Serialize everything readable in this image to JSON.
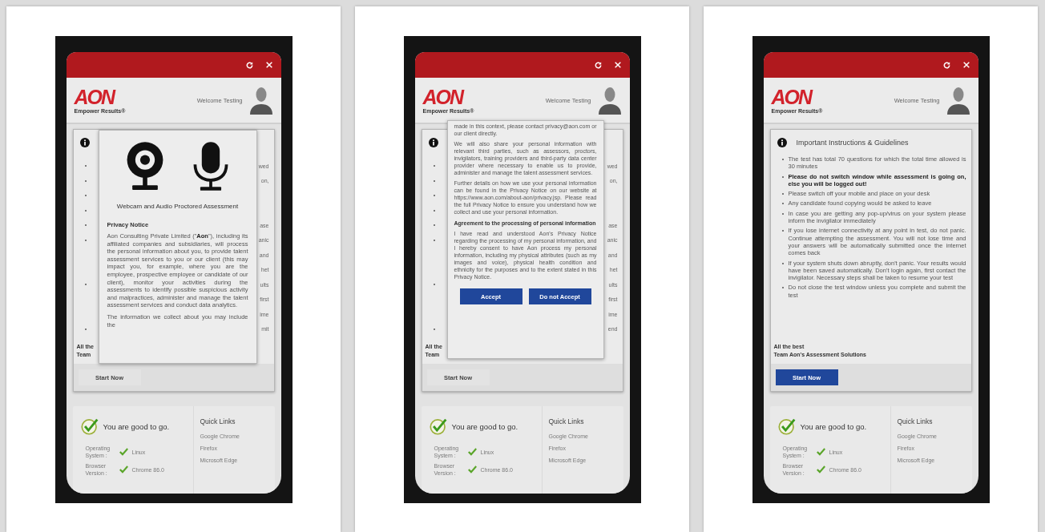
{
  "screens": [
    {
      "header": {
        "welcome": "Welcome Testing",
        "logo": "AON",
        "tagline": "Empower Results®"
      },
      "instructions": {
        "peek_lines": [
          {
            "kind": "bullet",
            "text": "wed"
          },
          {
            "kind": "bullet",
            "text": "on,"
          },
          {
            "kind": "bullet"
          },
          {
            "kind": "bullet"
          },
          {
            "kind": "bullet",
            "text": "ase"
          },
          {
            "kind": "bullet",
            "text": "anic"
          },
          {
            "kind": "line",
            "text": "and"
          },
          {
            "kind": "line",
            "text": "het"
          },
          {
            "kind": "bullet",
            "text": "ults"
          },
          {
            "kind": "line",
            "text": "first"
          },
          {
            "kind": "line",
            "text": "ime"
          },
          {
            "kind": "bullet",
            "text": "mit"
          }
        ],
        "signoff": [
          "All the",
          "Team"
        ],
        "start_button": {
          "label": "Start Now",
          "enabled": false
        }
      },
      "modal": {
        "kind": "intro",
        "blocks": [
          {
            "kind": "media"
          },
          {
            "kind": "title",
            "text": "Webcam and Audio Proctored Assessment"
          },
          {
            "kind": "heading",
            "text": "Privacy Notice"
          },
          {
            "kind": "paragraph",
            "text": "Aon Consulting Private Limited (\"**Aon**\"), including its affiliated companies and subsidiaries, will process the personal information about you, to provide talent assessment services to you or our client (this may impact you, for example, where you are the employee, prospective employee or candidate of our client), monitor your activities during the assessments to identify possible suspicious activity and malpractices, administer and manage the talent assessment services and conduct data analytics."
          },
          {
            "kind": "paragraph",
            "text": "The information we collect about you may include the"
          }
        ]
      },
      "status": {
        "title": "You are good to go.",
        "checks": [
          {
            "label": "Operating System :",
            "value": "Linux"
          },
          {
            "label": "Browser Version :",
            "value": "Chrome 86.0"
          }
        ],
        "quick_links": {
          "title": "Quick Links",
          "items": [
            "Google Chrome",
            "Firefox",
            "Microsoft Edge"
          ]
        }
      }
    },
    {
      "header": {
        "welcome": "Welcome Testing",
        "logo": "AON",
        "tagline": "Empower Results®"
      },
      "instructions": {
        "peek_lines": [
          {
            "kind": "bullet",
            "text": "wed"
          },
          {
            "kind": "bullet",
            "text": "on,"
          },
          {
            "kind": "bullet"
          },
          {
            "kind": "bullet"
          },
          {
            "kind": "bullet",
            "text": "ase"
          },
          {
            "kind": "bullet",
            "text": "anic"
          },
          {
            "kind": "line",
            "text": "and"
          },
          {
            "kind": "line",
            "text": "het"
          },
          {
            "kind": "bullet",
            "text": "ults"
          },
          {
            "kind": "line",
            "text": "first"
          },
          {
            "kind": "line",
            "text": "ime"
          },
          {
            "kind": "bullet",
            "text": "end"
          }
        ],
        "signoff": [
          "All the",
          "Team"
        ],
        "start_button": {
          "label": "Start Now",
          "enabled": false
        }
      },
      "modal": {
        "kind": "consent",
        "blocks": [
          {
            "kind": "paragraph",
            "text": "made in this context, please contact privacy@aon.com or our client directly."
          },
          {
            "kind": "paragraph",
            "text": "We will also share your personal information with relevant third parties, such as assessors, proctors, invigilators, training providers and third-party data center provider where necessary to enable us to provide, administer and manage the talent assessment services."
          },
          {
            "kind": "paragraph",
            "text": "Further details on how we use your personal information can be found in the Privacy Notice on our website at https://www.aon.com/about-aon/privacy.jsp. Please read the full Privacy Notice to ensure you understand how we collect and use your personal information."
          },
          {
            "kind": "heading",
            "text": "Agreement to the processing of personal information"
          },
          {
            "kind": "paragraph",
            "text": "I have read and understood Aon's Privacy Notice regarding the processing of my personal information, and I hereby consent to have Aon process my personal information, including my physical attributes (such as my images and voice), physical health condition and ethnicity for the purposes and to the extent stated in this Privacy Notice."
          }
        ],
        "buttons": [
          "Accept",
          "Do not Accept"
        ]
      },
      "status": {
        "title": "You are good to go.",
        "checks": [
          {
            "label": "Operating System :",
            "value": "Linux"
          },
          {
            "label": "Browser Version :",
            "value": "Chrome 86.0"
          }
        ],
        "quick_links": {
          "title": "Quick Links",
          "items": [
            "Google Chrome",
            "Firefox",
            "Microsoft Edge"
          ]
        }
      }
    },
    {
      "header": {
        "welcome": "Welcome Testing",
        "logo": "AON",
        "tagline": "Empower Results®"
      },
      "instructions": {
        "title": "Important Instructions & Guidelines",
        "bullets": [
          {
            "kind": "normal",
            "text": "The test has total 70 questions for which the total time allowed is 30 minutes"
          },
          {
            "kind": "warning",
            "text": "Please do not switch window while assessment is going on, else you will be logged out!"
          },
          {
            "kind": "normal",
            "text": "Please switch off your mobile and place on your desk"
          },
          {
            "kind": "normal",
            "text": "Any candidate found copying would be asked to leave"
          },
          {
            "kind": "normal",
            "text": "In case you are getting any pop-up/virus on your system please inform the invigilator immediately"
          },
          {
            "kind": "normal",
            "text": "If you lose internet connectivity at any point in test, do not panic. Continue attempting the assessment. You will not lose time and your answers will be automatically submitted once the internet comes back"
          },
          {
            "kind": "normal",
            "text": "If your system shuts down abruptly, don't panic. Your results would have been saved automatically. Don't login again, first contact the invigilator. Necessary steps shall be taken to resume your test"
          },
          {
            "kind": "normal",
            "text": "Do not close the test window unless you complete and submit the test"
          }
        ],
        "signoff": [
          "All the best",
          "Team Aon's Assessment Solutions"
        ],
        "start_button": {
          "label": "Start Now",
          "enabled": true
        }
      },
      "status": {
        "title": "You are good to go.",
        "checks": [
          {
            "label": "Operating System :",
            "value": "Linux"
          },
          {
            "label": "Browser Version :",
            "value": "Chrome 86.0"
          }
        ],
        "quick_links": {
          "title": "Quick Links",
          "items": [
            "Google Chrome",
            "Firefox",
            "Microsoft Edge"
          ]
        }
      }
    }
  ]
}
